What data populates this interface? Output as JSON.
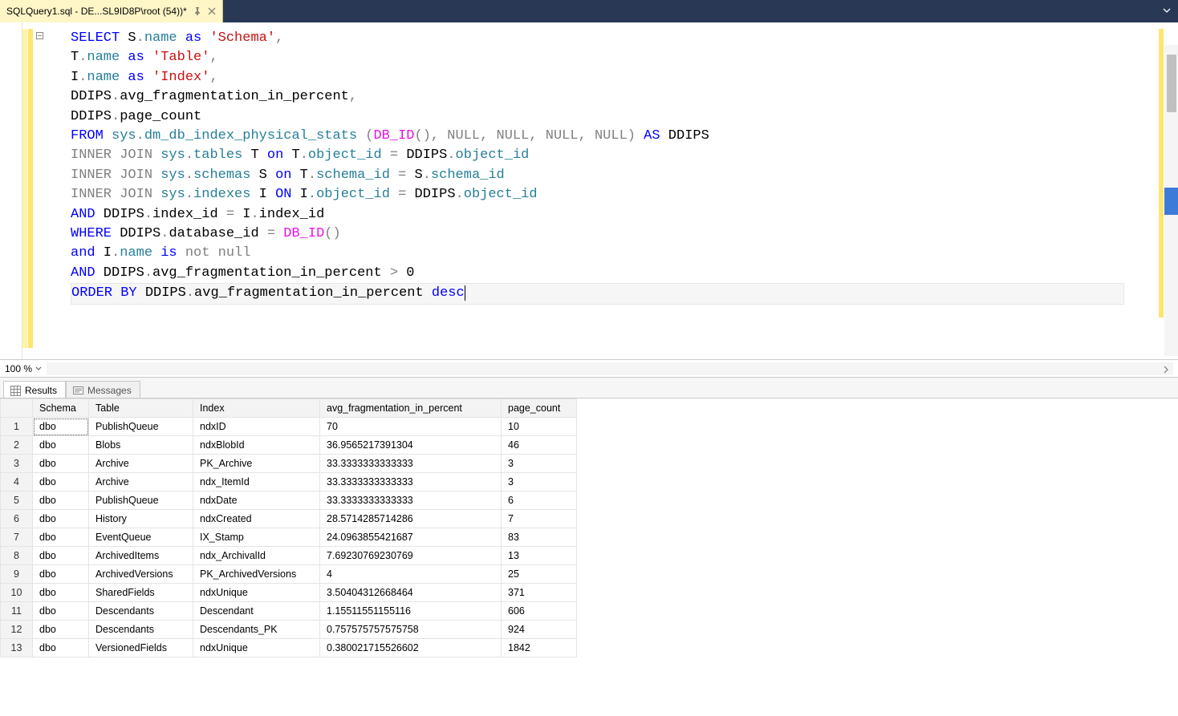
{
  "tab": {
    "title": "SQLQuery1.sql - DE...SL9ID8P\\root (54))*"
  },
  "zoom": {
    "value": "100 %"
  },
  "result_tabs": {
    "results": "Results",
    "messages": "Messages"
  },
  "columns": {
    "schema": "Schema",
    "table": "Table",
    "index": "Index",
    "frag": "avg_fragmentation_in_percent",
    "page": "page_count"
  },
  "rows": [
    {
      "n": "1",
      "schema": "dbo",
      "table": "PublishQueue",
      "index": "ndxID",
      "frag": "70",
      "page": "10"
    },
    {
      "n": "2",
      "schema": "dbo",
      "table": "Blobs",
      "index": "ndxBlobId",
      "frag": "36.9565217391304",
      "page": "46"
    },
    {
      "n": "3",
      "schema": "dbo",
      "table": "Archive",
      "index": "PK_Archive",
      "frag": "33.3333333333333",
      "page": "3"
    },
    {
      "n": "4",
      "schema": "dbo",
      "table": "Archive",
      "index": "ndx_ItemId",
      "frag": "33.3333333333333",
      "page": "3"
    },
    {
      "n": "5",
      "schema": "dbo",
      "table": "PublishQueue",
      "index": "ndxDate",
      "frag": "33.3333333333333",
      "page": "6"
    },
    {
      "n": "6",
      "schema": "dbo",
      "table": "History",
      "index": "ndxCreated",
      "frag": "28.5714285714286",
      "page": "7"
    },
    {
      "n": "7",
      "schema": "dbo",
      "table": "EventQueue",
      "index": "IX_Stamp",
      "frag": "24.0963855421687",
      "page": "83"
    },
    {
      "n": "8",
      "schema": "dbo",
      "table": "ArchivedItems",
      "index": "ndx_ArchivalId",
      "frag": "7.69230769230769",
      "page": "13"
    },
    {
      "n": "9",
      "schema": "dbo",
      "table": "ArchivedVersions",
      "index": "PK_ArchivedVersions",
      "frag": "4",
      "page": "25"
    },
    {
      "n": "10",
      "schema": "dbo",
      "table": "SharedFields",
      "index": "ndxUnique",
      "frag": "3.50404312668464",
      "page": "371"
    },
    {
      "n": "11",
      "schema": "dbo",
      "table": "Descendants",
      "index": "Descendant",
      "frag": "1.15511551155116",
      "page": "606"
    },
    {
      "n": "12",
      "schema": "dbo",
      "table": "Descendants",
      "index": "Descendants_PK",
      "frag": "0.757575757575758",
      "page": "924"
    },
    {
      "n": "13",
      "schema": "dbo",
      "table": "VersionedFields",
      "index": "ndxUnique",
      "frag": "0.380021715526602",
      "page": "1842"
    }
  ],
  "sql": {
    "l1a": "SELECT",
    "l1b": " S",
    "l1c": ".",
    "l1d": "name",
    "l1e": " as ",
    "l1f": "'Schema'",
    "l1g": ",",
    "l2a": "T",
    "l2b": ".",
    "l2c": "name",
    "l2d": " as ",
    "l2e": "'Table'",
    "l2f": ",",
    "l3a": "I",
    "l3b": ".",
    "l3c": "name",
    "l3d": " as ",
    "l3e": "'Index'",
    "l3f": ",",
    "l4a": "DDIPS",
    "l4b": ".",
    "l4c": "avg_fragmentation_in_percent",
    "l4d": ",",
    "l5a": "DDIPS",
    "l5b": ".",
    "l5c": "page_count",
    "l6a": "FROM",
    "l6b": " sys",
    "l6c": ".",
    "l6d": "dm_db_index_physical_stats ",
    "l6e": "(",
    "l6f": "DB_ID",
    "l6g": "(),",
    "l6h": " NULL",
    "l6i": ",",
    "l6j": " NULL",
    "l6k": ",",
    "l6l": " NULL",
    "l6m": ",",
    "l6n": " NULL",
    "l6o": ")",
    "l6p": " AS",
    "l6q": " DDIPS",
    "l7a": "INNER",
    "l7b": " JOIN",
    "l7c": " sys",
    "l7d": ".",
    "l7e": "tables",
    "l7f": " T ",
    "l7g": "on",
    "l7h": " T",
    "l7i": ".",
    "l7j": "object_id ",
    "l7k": "=",
    "l7l": " DDIPS",
    "l7m": ".",
    "l7n": "object_id",
    "l8a": "INNER",
    "l8b": " JOIN",
    "l8c": " sys",
    "l8d": ".",
    "l8e": "schemas",
    "l8f": " S ",
    "l8g": "on",
    "l8h": " T",
    "l8i": ".",
    "l8j": "schema_id ",
    "l8k": "=",
    "l8l": " S",
    "l8m": ".",
    "l8n": "schema_id",
    "l9a": "INNER",
    "l9b": " JOIN",
    "l9c": " sys",
    "l9d": ".",
    "l9e": "indexes",
    "l9f": " I ",
    "l9g": "ON",
    "l9h": " I",
    "l9i": ".",
    "l9j": "object_id ",
    "l9k": "=",
    "l9l": " DDIPS",
    "l9m": ".",
    "l9n": "object_id",
    "l10a": "AND",
    "l10b": " DDIPS",
    "l10c": ".",
    "l10d": "index_id ",
    "l10e": "=",
    "l10f": " I",
    "l10g": ".",
    "l10h": "index_id",
    "l11a": "WHERE",
    "l11b": " DDIPS",
    "l11c": ".",
    "l11d": "database_id ",
    "l11e": "=",
    "l11f": " DB_ID",
    "l11g": "()",
    "l12a": "and",
    "l12b": " I",
    "l12c": ".",
    "l12d": "name ",
    "l12e": "is",
    "l12f": " not null",
    "l13a": "AND",
    "l13b": " DDIPS",
    "l13c": ".",
    "l13d": "avg_fragmentation_in_percent ",
    "l13e": ">",
    "l13f": " 0",
    "l14a": "ORDER",
    "l14b": " BY",
    "l14c": " DDIPS",
    "l14d": ".",
    "l14e": "avg_fragmentation_in_percent ",
    "l14f": "desc"
  }
}
